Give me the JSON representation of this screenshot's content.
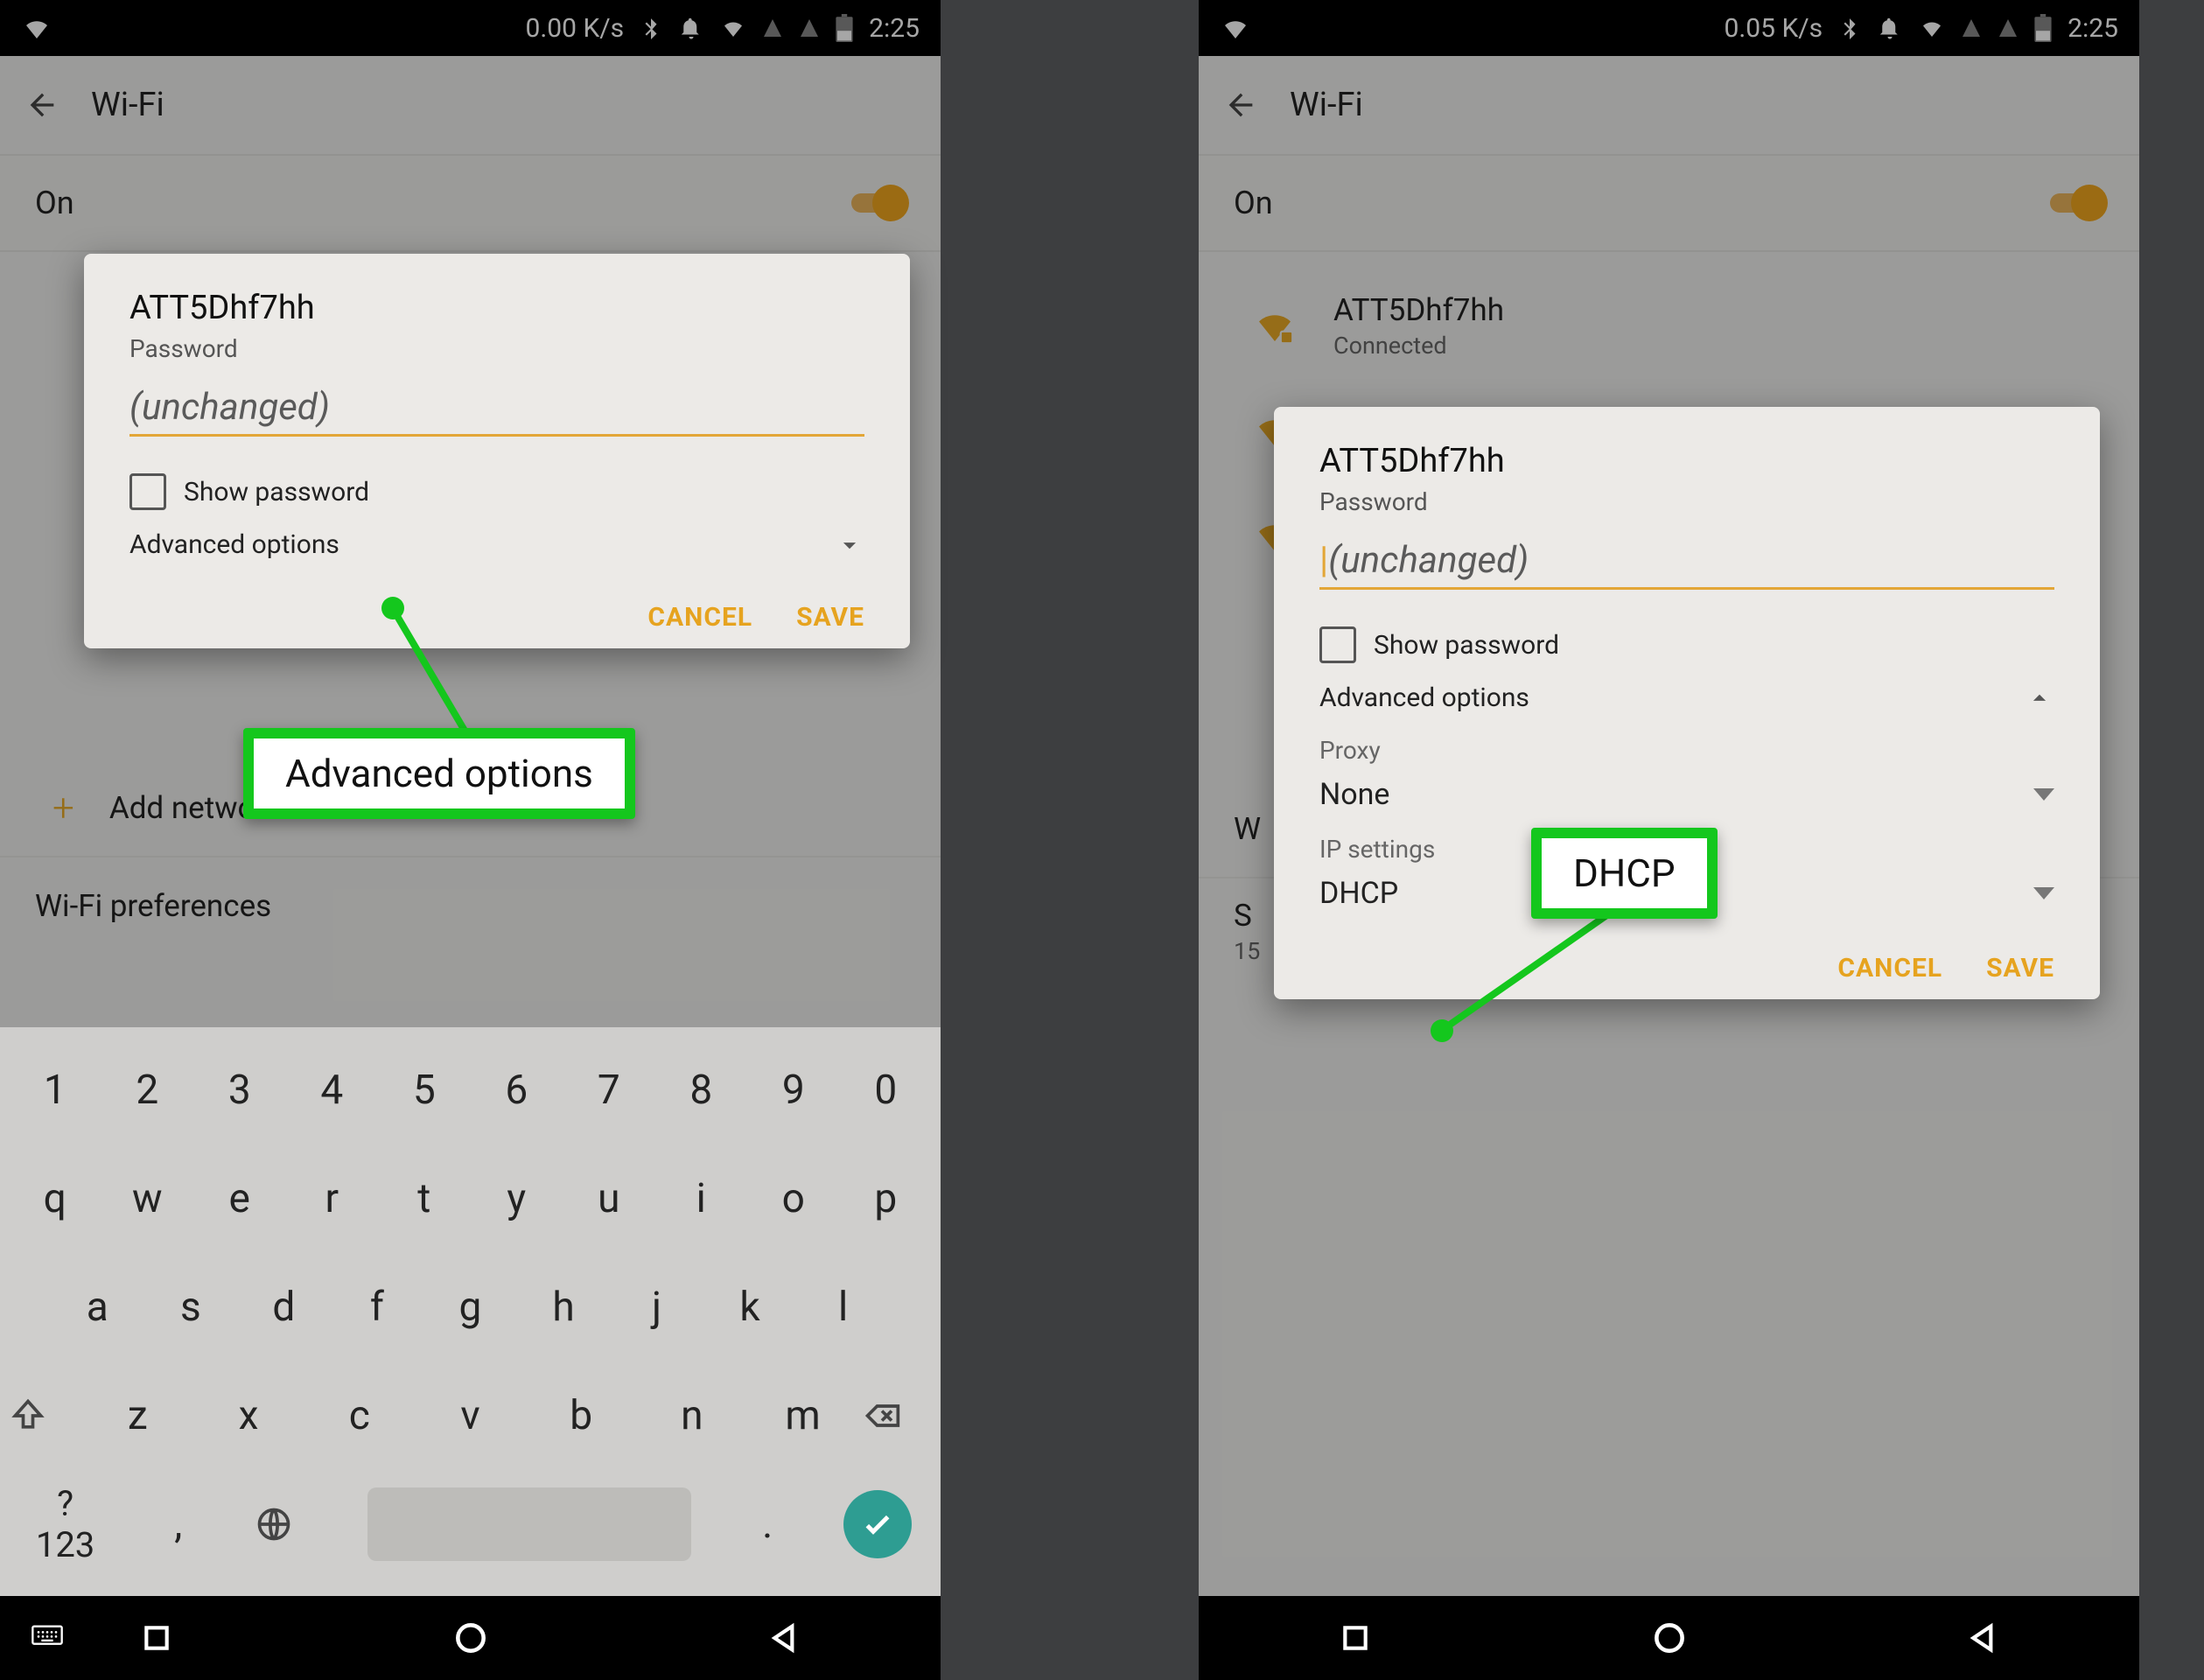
{
  "left": {
    "statusbar": {
      "speed": "0.00 K/s",
      "time": "2:25"
    },
    "appbar_title": "Wi-Fi",
    "wifi_toggle_label": "On",
    "add_network_label": "Add network",
    "preferences_label": "Wi-Fi preferences",
    "dialog": {
      "ssid": "ATT5Dhf7hh",
      "password_label": "Password",
      "password_placeholder": "(unchanged)",
      "show_password": "Show password",
      "advanced_options": "Advanced options",
      "cancel": "CANCEL",
      "save": "SAVE"
    },
    "keyboard": {
      "row1": [
        "1",
        "2",
        "3",
        "4",
        "5",
        "6",
        "7",
        "8",
        "9",
        "0"
      ],
      "row2": [
        "q",
        "w",
        "e",
        "r",
        "t",
        "y",
        "u",
        "i",
        "o",
        "p"
      ],
      "row3": [
        "a",
        "s",
        "d",
        "f",
        "g",
        "h",
        "j",
        "k",
        "l"
      ],
      "row4": [
        "z",
        "x",
        "c",
        "v",
        "b",
        "n",
        "m"
      ],
      "sym": "?123",
      "comma": ",",
      "period": "."
    },
    "callout": "Advanced options"
  },
  "right": {
    "statusbar": {
      "speed": "0.05 K/s",
      "time": "2:25"
    },
    "appbar_title": "Wi-Fi",
    "wifi_toggle_label": "On",
    "bg_network": {
      "name": "ATT5Dhf7hh",
      "status": "Connected"
    },
    "bg_rows": {
      "pref_initial": "W",
      "saved_initial": "S",
      "saved_sub": "15"
    },
    "dialog": {
      "ssid": "ATT5Dhf7hh",
      "password_label": "Password",
      "password_placeholder": "(unchanged)",
      "show_password": "Show password",
      "advanced_options": "Advanced options",
      "proxy_label": "Proxy",
      "proxy_value": "None",
      "ip_label": "IP settings",
      "ip_value": "DHCP",
      "cancel": "CANCEL",
      "save": "SAVE"
    },
    "callout": "DHCP"
  }
}
